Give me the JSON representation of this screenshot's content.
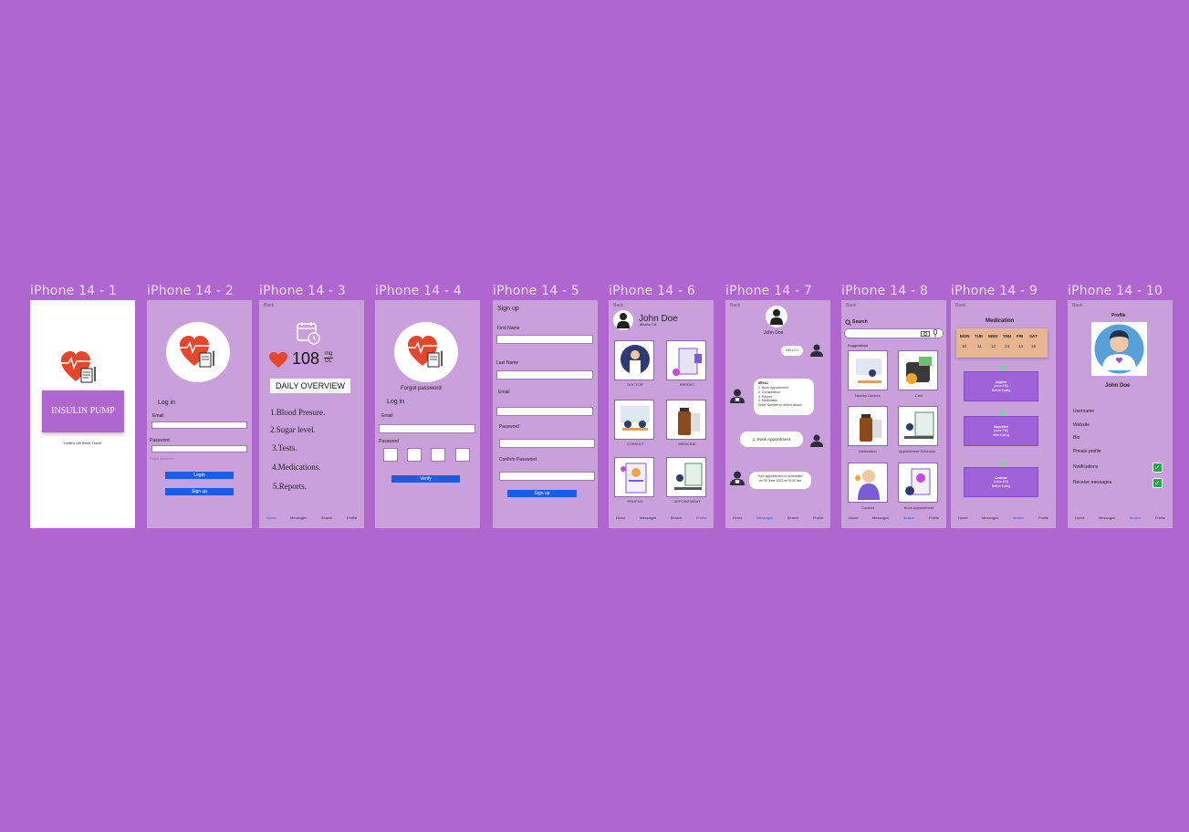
{
  "frames": [
    {
      "label": "iPhone 14 - 1"
    },
    {
      "label": "iPhone 14 - 2"
    },
    {
      "label": "iPhone 14 - 3"
    },
    {
      "label": "iPhone 14 - 4"
    },
    {
      "label": "iPhone 14 - 5"
    },
    {
      "label": "iPhone 14 - 6"
    },
    {
      "label": "iPhone 14 - 7"
    },
    {
      "label": "iPhone 14 - 8"
    },
    {
      "label": "iPhone 14 - 9"
    },
    {
      "label": "iPhone 14 - 10"
    }
  ],
  "common": {
    "back": "Back"
  },
  "tabs": {
    "home": "Home",
    "messages": "Messages",
    "search": "Search",
    "profile": "Profile"
  },
  "splash": {
    "title": "INSULIN PUMP",
    "tagline": "\"Healthy Life,Better Future\""
  },
  "login": {
    "heading": "Log in",
    "email_label": "Email",
    "password_label": "Password",
    "forgot": "Forgot password",
    "login_button": "Login",
    "signup_button": "Sign up"
  },
  "overview": {
    "glucose_value": "108",
    "unit_top": "mg",
    "unit_bottom": "DL",
    "title": "DAILY OVERVIEW",
    "items": [
      "1.Blood Presure.",
      "2.Sugar level.",
      "3.Tests.",
      "4.Medications.",
      "5.Reports."
    ]
  },
  "verify": {
    "forgot_title": "Forgot password",
    "heading": "Log in",
    "email_label": "Email",
    "password_label": "Password",
    "verify_button": "Verify"
  },
  "signup": {
    "title": "Sign up",
    "first_name": "First Name",
    "last_name": "Last Name",
    "email": "Email",
    "password": "Password",
    "confirm": "Confirm Password",
    "button": "Sign up"
  },
  "home": {
    "name": "John Doe",
    "location": "Alberta, CA",
    "tiles": [
      "DOCTOR",
      "REPORT",
      "CONSULT",
      "MEDICINE",
      "PROFILE",
      "APPOINTMENT"
    ]
  },
  "chat": {
    "name": "John Doe",
    "hello": "HELLO !",
    "menu_lines": [
      "MENU",
      "1. Book Appointment",
      "2. Consultation",
      "3. Report",
      "4. Medication",
      "Enter Number to select above"
    ],
    "reply": "1. Book Appointment",
    "confirm_lines": [
      "Your appointment is scheduled",
      "on 30 June 2023 at 11:00 am"
    ]
  },
  "search": {
    "label": "Search",
    "suggestions": "Suggestions",
    "tiles": [
      "Nearby Doctors",
      "Cost",
      "Medication",
      "Appointment Schedule",
      "Contact",
      "Book Appointment"
    ]
  },
  "medication": {
    "title": "Medication",
    "days": [
      "MON",
      "TUE",
      "WED",
      "THU",
      "FRI",
      "SAT"
    ],
    "dates": [
      "10",
      "11",
      "12",
      "13",
      "14",
      "15"
    ],
    "cards": [
      {
        "name": "Aspirin",
        "line1": "(once AM)",
        "line2": "Before Eating"
      },
      {
        "name": "Ibuprofen",
        "line1": "(once PM)",
        "line2": "After Eating"
      },
      {
        "name": "Codeine",
        "line1": "(once AM)",
        "line2": "Before Eating"
      }
    ]
  },
  "profile": {
    "title": "Profile",
    "name": "John Doe",
    "rows": [
      "Username",
      "Website",
      "Bio",
      "Private profile"
    ],
    "notifications": "Notifications",
    "receive": "Receive messages"
  },
  "colors": {
    "background": "#b066cf",
    "frame": "#c9a0db",
    "button": "#1f5ce6",
    "heart": "#e5462c",
    "card": "#a062d9",
    "calendar": "#e8b592"
  }
}
